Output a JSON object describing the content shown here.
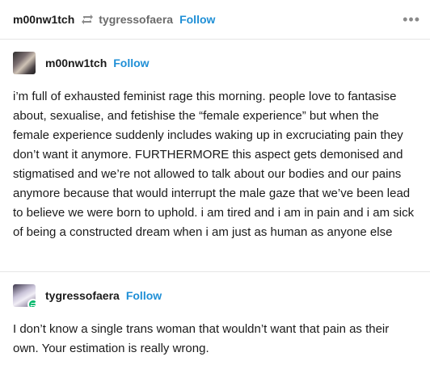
{
  "header": {
    "poster": "m00nw1tch",
    "reblogged_from": "tygressofaera",
    "follow_label": "Follow",
    "more_label": "•••"
  },
  "posts": [
    {
      "username": "m00nw1tch",
      "follow_label": "Follow",
      "text": "i’m full of exhausted feminist rage this morning. people love to fantasise about, sexualise, and fetishise the “female experience” but when the female experience suddenly includes waking up in excruciating pain they don’t want it anymore. FURTHERMORE this aspect gets demonised and stigmatised and we’re not allowed to talk about our bodies and our pains anymore because that would interrupt the male gaze that we’ve been lead to believe we were born to uphold. i am tired and i am in pain and i am sick of being a constructed dream when i am just as human as anyone else"
    },
    {
      "username": "tygressofaera",
      "follow_label": "Follow",
      "text": "I don’t know a single trans woman that wouldn’t want that pain as their own. Your estimation is really wrong."
    }
  ],
  "colors": {
    "accent": "#1f8fd6",
    "reblog_badge": "#00b86b"
  }
}
